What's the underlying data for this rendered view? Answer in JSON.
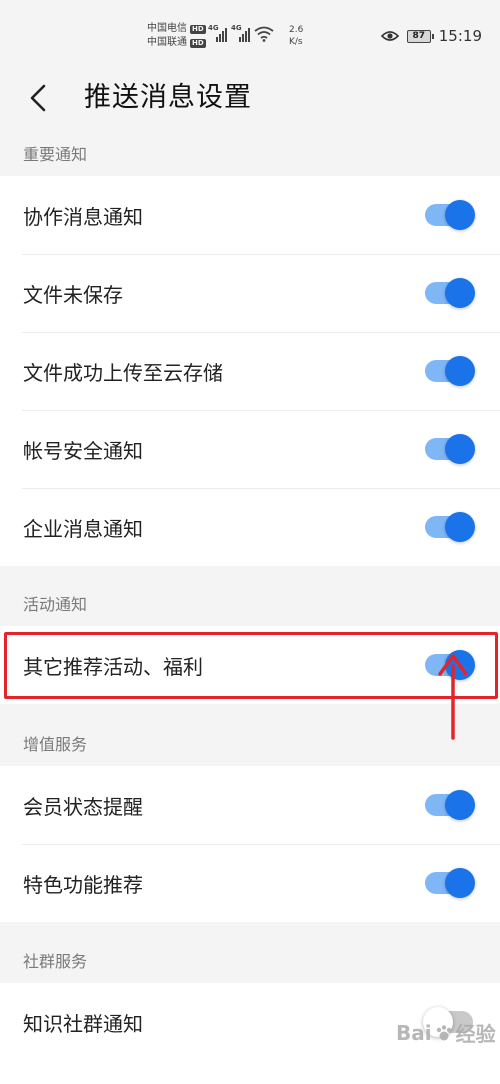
{
  "status_bar": {
    "carrier1": "中国电信",
    "carrier2": "中国联通",
    "hd": "HD",
    "net1": "4G",
    "net2": "4G",
    "speed_value": "2.6",
    "speed_unit": "K/s",
    "battery": "87",
    "time": "15:19"
  },
  "header": {
    "title": "推送消息设置"
  },
  "sections": {
    "important": {
      "label": "重要通知",
      "items": [
        {
          "label": "协作消息通知",
          "on": true
        },
        {
          "label": "文件未保存",
          "on": true
        },
        {
          "label": "文件成功上传至云存储",
          "on": true
        },
        {
          "label": "帐号安全通知",
          "on": true
        },
        {
          "label": "企业消息通知",
          "on": true
        }
      ]
    },
    "activity": {
      "label": "活动通知",
      "items": [
        {
          "label": "其它推荐活动、福利",
          "on": true
        }
      ]
    },
    "value_added": {
      "label": "增值服务",
      "items": [
        {
          "label": "会员状态提醒",
          "on": true
        },
        {
          "label": "特色功能推荐",
          "on": true
        }
      ]
    },
    "community": {
      "label": "社群服务",
      "items": [
        {
          "label": "知识社群通知",
          "on": false
        }
      ]
    }
  },
  "colors": {
    "toggle_on_track": "#7fb6f6",
    "toggle_on_knob": "#1a73e8",
    "toggle_off_track": "#c9c9c9",
    "annotation": "#e3242b"
  },
  "watermark": {
    "text1": "Bai",
    "text2": "经验"
  }
}
